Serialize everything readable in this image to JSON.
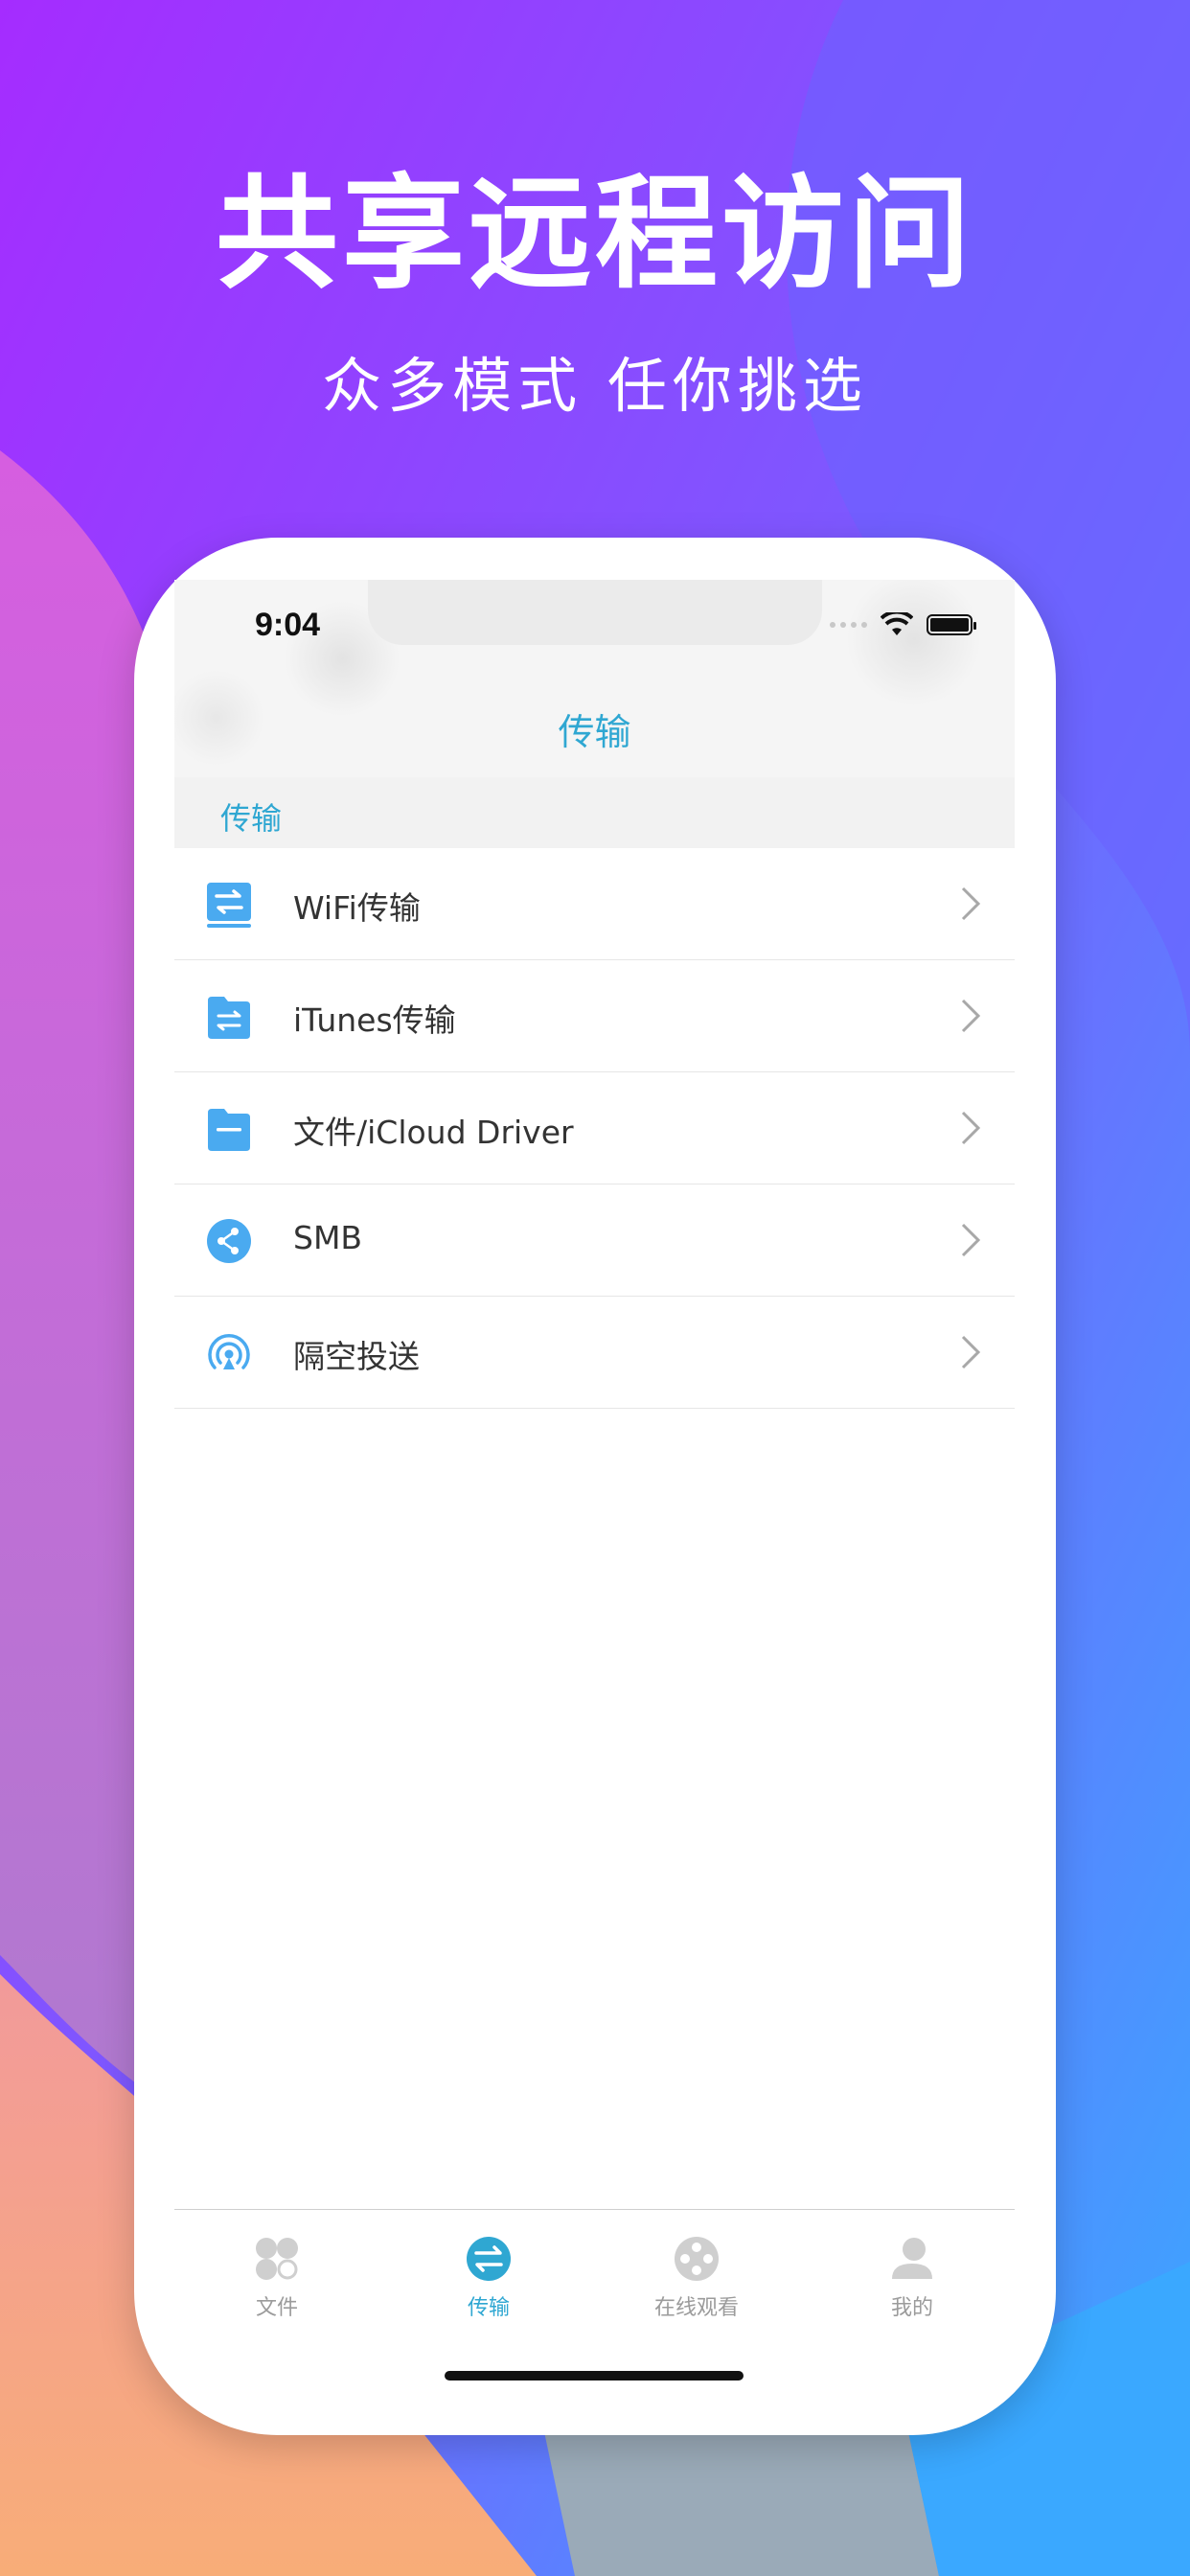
{
  "promo": {
    "headline": "共享远程访问",
    "subline": "众多模式 任你挑选"
  },
  "status_bar": {
    "time": "9:04"
  },
  "nav": {
    "title": "传输"
  },
  "section": {
    "label": "传输"
  },
  "list_items": [
    {
      "label": "WiFi传输",
      "icon": "wifi-transfer-icon"
    },
    {
      "label": "iTunes传输",
      "icon": "itunes-transfer-icon"
    },
    {
      "label": "文件/iCloud Driver",
      "icon": "folder-icon"
    },
    {
      "label": "SMB",
      "icon": "share-icon"
    },
    {
      "label": "隔空投送",
      "icon": "airdrop-icon"
    }
  ],
  "tabs": [
    {
      "label": "文件",
      "icon": "files-icon",
      "active": false
    },
    {
      "label": "传输",
      "icon": "transfer-icon",
      "active": true
    },
    {
      "label": "在线观看",
      "icon": "film-reel-icon",
      "active": false
    },
    {
      "label": "我的",
      "icon": "profile-icon",
      "active": false
    }
  ],
  "colors": {
    "accent": "#2fa7d2",
    "icon_blue": "#4aaaf0",
    "bg_purple": "#a52cff",
    "bg_blue": "#3aa8ff",
    "bg_orange": "#f8a878"
  }
}
